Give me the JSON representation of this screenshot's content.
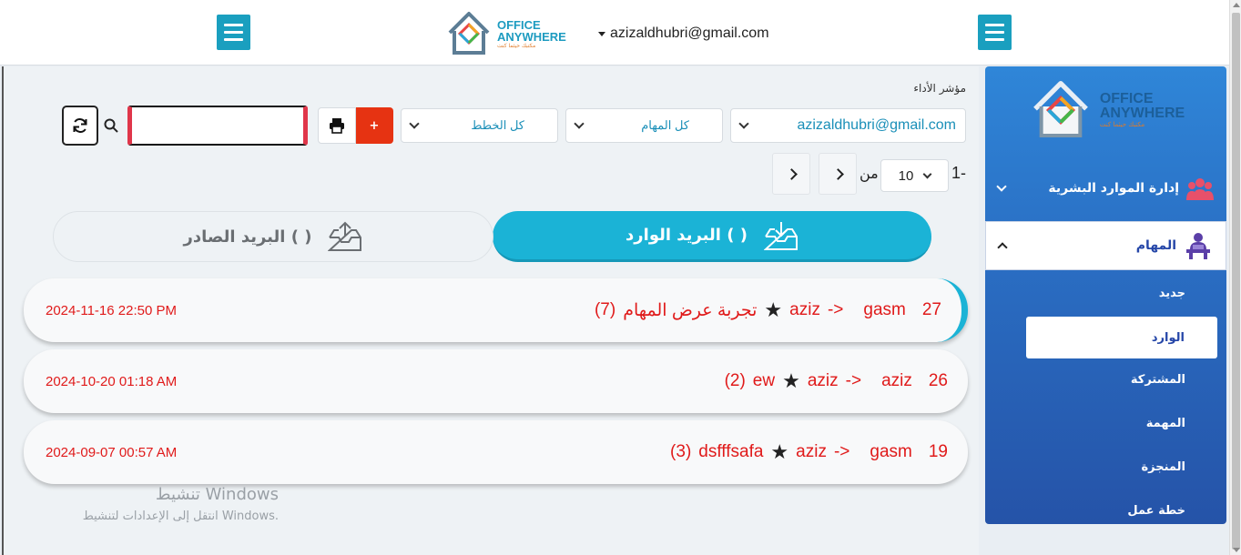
{
  "header": {
    "user_email": "azizaldhubri@gmail.com",
    "logo_line1": "OFFICE",
    "logo_line2": "ANYWHERE",
    "logo_tagline": "مكتبك حيثما كنت"
  },
  "toolbar": {
    "perf_label": "مؤشر الأداء",
    "user_filter": "azizaldhubri@gmail.com",
    "tasks_filter": "كل المهام",
    "plans_filter": "كل الخطط",
    "add_label": "+",
    "search_value": ""
  },
  "pager": {
    "range_label": "1-",
    "page_size": "10",
    "of_label": "من"
  },
  "tabs": {
    "inbox": "البريد الوارد ( )",
    "outbox": "البريد الصادر ( )"
  },
  "messages": [
    {
      "num": "27",
      "from": "gasm",
      "arrow": "->",
      "to": "aziz",
      "title": "تجربة عرض المهام",
      "count": "(7)",
      "date": "2024-11-16 22:50 PM"
    },
    {
      "num": "26",
      "from": "aziz",
      "arrow": "->",
      "to": "aziz",
      "title": "ew",
      "count": "(2)",
      "date": "2024-10-20 01:18 AM"
    },
    {
      "num": "19",
      "from": "gasm",
      "arrow": "->",
      "to": "aziz",
      "title": "dsfffsafa",
      "count": "(3)",
      "date": "2024-09-07 00:57 AM"
    }
  ],
  "watermark": {
    "line1": "تنشيط Windows",
    "line2": "انتقل إلى الإعدادات لتنشيط Windows."
  },
  "sidebar": {
    "hr_label": "إدارة الموارد البشرية",
    "tasks_label": "المهام",
    "items": [
      "جديد",
      "الوارد",
      "المشتركة",
      "المهمة",
      "المنجزة",
      "خطة عمل"
    ]
  },
  "colors": {
    "accent": "#1bb3d6",
    "danger": "#e63312",
    "sidebar": "#2a6fc4"
  }
}
